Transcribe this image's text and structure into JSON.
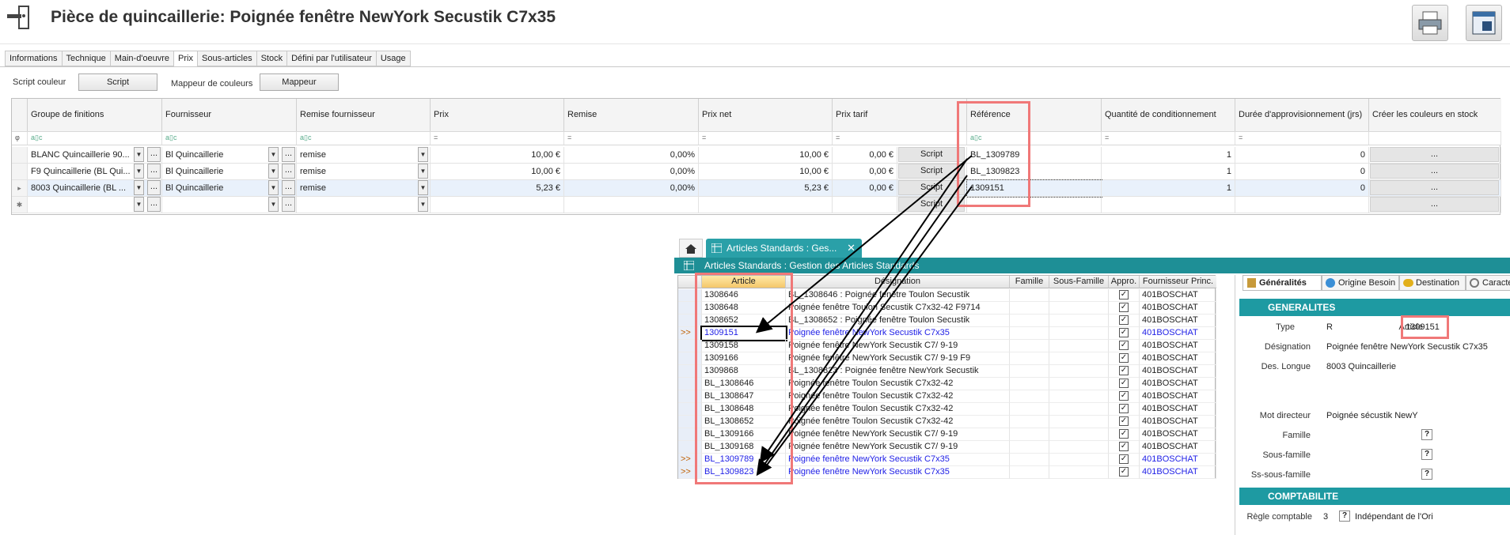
{
  "header": {
    "title": "Pièce de quincaillerie: Poignée fenêtre NewYork Secustik C7x35"
  },
  "tabs": [
    "Informations",
    "Technique",
    "Main-d'oeuvre",
    "Prix",
    "Sous-articles",
    "Stock",
    "Défini par l'utilisateur",
    "Usage"
  ],
  "active_tab": "Prix",
  "toolbar": {
    "script_couleur_label": "Script couleur",
    "script_button": "Script",
    "mappeur_label": "Mappeur de couleurs",
    "mappeur_button": "Mappeur"
  },
  "grid": {
    "columns": [
      "Groupe de finitions",
      "Fournisseur",
      "Remise fournisseur",
      "Prix",
      "Remise",
      "Prix net",
      "Prix tarif",
      "Référence",
      "Quantité de conditionnement",
      "Durée d'approvisionnement (jrs)",
      "Créer les couleurs en stock"
    ],
    "filter_symbol_text": "a▯c",
    "filter_symbol_eq": "=",
    "rows": [
      {
        "groupe": "BLANC Quincaillerie 90...",
        "fournisseur": "Bl Quincaillerie",
        "remise_f": "remise",
        "prix": "10,00 €",
        "remise": "0,00%",
        "prix_net": "10,00 €",
        "prix_tarif": "0,00 €",
        "script": "Script",
        "reference": "BL_1309789",
        "qte": "1",
        "duree": "0",
        "creer": "..."
      },
      {
        "groupe": "F9 Quincaillerie (BL Qui...",
        "fournisseur": "Bl Quincaillerie",
        "remise_f": "remise",
        "prix": "10,00 €",
        "remise": "0,00%",
        "prix_net": "10,00 €",
        "prix_tarif": "0,00 €",
        "script": "Script",
        "reference": "BL_1309823",
        "qte": "1",
        "duree": "0",
        "creer": "..."
      },
      {
        "groupe": "8003 Quincaillerie (BL ...",
        "fournisseur": "Bl Quincaillerie",
        "remise_f": "remise",
        "prix": "5,23 €",
        "remise": "0,00%",
        "prix_net": "5,23 €",
        "prix_tarif": "0,00 €",
        "script": "Script",
        "reference": "1309151",
        "qte": "1",
        "duree": "0",
        "creer": "..."
      },
      {
        "groupe": "",
        "fournisseur": "",
        "remise_f": "",
        "prix": "",
        "remise": "",
        "prix_net": "",
        "prix_tarif": "",
        "script": "Script",
        "reference": "",
        "qte": "",
        "duree": "",
        "creer": "..."
      }
    ]
  },
  "window2": {
    "tab_title": "Articles Standards : Ges...",
    "subtitle": "Articles Standards : Gestion des Articles Standards",
    "columns": [
      "Article",
      "Désignation",
      "Famille",
      "Sous-Famille",
      "Appro.",
      "Fournisseur Princ."
    ],
    "rows": [
      {
        "mark": "",
        "article": "1308646",
        "designation": "BL_1308646 : Poignée fenêtre Toulon Secustik",
        "fournisseur": "401BOSCHAT",
        "blue": false
      },
      {
        "mark": "",
        "article": "1308648",
        "designation": "Poignée fenêtre Toulon Secustik C7x32-42 F9714",
        "fournisseur": "401BOSCHAT",
        "blue": false
      },
      {
        "mark": "",
        "article": "1308652",
        "designation": "BL_1308652 : Poignée fenêtre Toulon Secustik",
        "fournisseur": "401BOSCHAT",
        "blue": false
      },
      {
        "mark": ">>",
        "article": "1309151",
        "designation": "Poignée fenêtre NewYork Secustik C7x35",
        "fournisseur": "401BOSCHAT",
        "blue": true
      },
      {
        "mark": "",
        "article": "1309158",
        "designation": "Poignée fenêtre NewYork Secustik C7/ 9-19",
        "fournisseur": "401BOSCHAT",
        "blue": false
      },
      {
        "mark": "",
        "article": "1309166",
        "designation": "Poignée fenêtre NewYork Secustik C7/ 9-19  F9",
        "fournisseur": "401BOSCHAT",
        "blue": false
      },
      {
        "mark": "",
        "article": "1309868",
        "designation": "BL_1308823 : Poignée fenêtre NewYork Secustik",
        "fournisseur": "401BOSCHAT",
        "blue": false
      },
      {
        "mark": "",
        "article": "BL_1308646",
        "designation": "Poignée fenêtre Toulon Secustik C7x32-42",
        "fournisseur": "401BOSCHAT",
        "blue": false
      },
      {
        "mark": "",
        "article": "BL_1308647",
        "designation": "Poignée fenêtre Toulon Secustik C7x32-42",
        "fournisseur": "401BOSCHAT",
        "blue": false
      },
      {
        "mark": "",
        "article": "BL_1308648",
        "designation": "Poignée fenêtre Toulon Secustik C7x32-42",
        "fournisseur": "401BOSCHAT",
        "blue": false
      },
      {
        "mark": "",
        "article": "BL_1308652",
        "designation": "Poignée fenêtre Toulon Secustik C7x32-42",
        "fournisseur": "401BOSCHAT",
        "blue": false
      },
      {
        "mark": "",
        "article": "BL_1309166",
        "designation": "Poignée fenêtre NewYork Secustik C7/ 9-19",
        "fournisseur": "401BOSCHAT",
        "blue": false
      },
      {
        "mark": "",
        "article": "BL_1309168",
        "designation": "Poignée fenêtre NewYork Secustik C7/ 9-19",
        "fournisseur": "401BOSCHAT",
        "blue": false
      },
      {
        "mark": ">>",
        "article": "BL_1309789",
        "designation": "Poignée fenêtre NewYork Secustik C7x35",
        "fournisseur": "401BOSCHAT",
        "blue": true
      },
      {
        "mark": ">>",
        "article": "BL_1309823",
        "designation": "Poignée fenêtre NewYork Secustik C7x35",
        "fournisseur": "401BOSCHAT",
        "blue": true
      }
    ]
  },
  "right_panel": {
    "tabs": [
      "Généralités",
      "Origine Besoin",
      "Destination",
      "Caractér"
    ],
    "section_generalites": "GENERALITES",
    "type_label": "Type",
    "type_value": "R",
    "article_label": "Article",
    "article_value": "1309151",
    "designation_label": "Désignation",
    "designation_value": "Poignée fenêtre NewYork Secustik C7x35",
    "des_longue_label": "Des. Longue",
    "des_longue_value": "8003 Quincaillerie",
    "mot_directeur_label": "Mot directeur",
    "mot_directeur_value": "Poignée sécustik NewY",
    "famille_label": "Famille",
    "sous_famille_label": "Sous-famille",
    "ss_sous_famille_label": "Ss-sous-famille",
    "question_mark": "?",
    "section_comptabilite": "COMPTABILITE",
    "regle_label": "Règle comptable",
    "regle_value": "3",
    "regle_desc": "Indépendant de l'Ori"
  },
  "colors": {
    "accent_teal": "#2aa0a8",
    "highlight_red": "#f07878",
    "link_blue": "#1e1ee6"
  }
}
